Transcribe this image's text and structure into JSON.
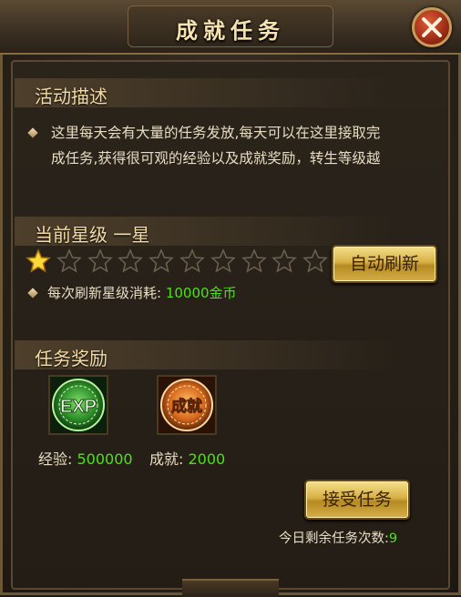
{
  "window": {
    "title": "成就任务"
  },
  "activity": {
    "heading": "活动描述",
    "lines": [
      "这里每天会有大量的任务发放,每天可以在这里接取完",
      "成任务,获得很可观的经验以及成就奖励，转生等级越"
    ]
  },
  "star_level": {
    "heading": "当前星级  一星",
    "stars_filled": 1,
    "stars_total": 10,
    "auto_refresh_label": "自动刷新",
    "cost_label": "每次刷新星级消耗:",
    "cost_value": "10000金币"
  },
  "rewards": {
    "heading": "任务奖励",
    "exp_icon_text": "EXP",
    "achievement_icon_text": "成就",
    "exp_label": "经验:",
    "exp_value": "500000",
    "achievement_label": "成就:",
    "achievement_value": "2000"
  },
  "accept_button_label": "接受任务",
  "remaining": {
    "label": "今日剩余任务次数:",
    "value": "9"
  },
  "colors": {
    "accent_gold": "#d8b045",
    "value_green": "#4de11d",
    "heading_text": "#f2dba6",
    "close_red": "#c63d1d"
  }
}
